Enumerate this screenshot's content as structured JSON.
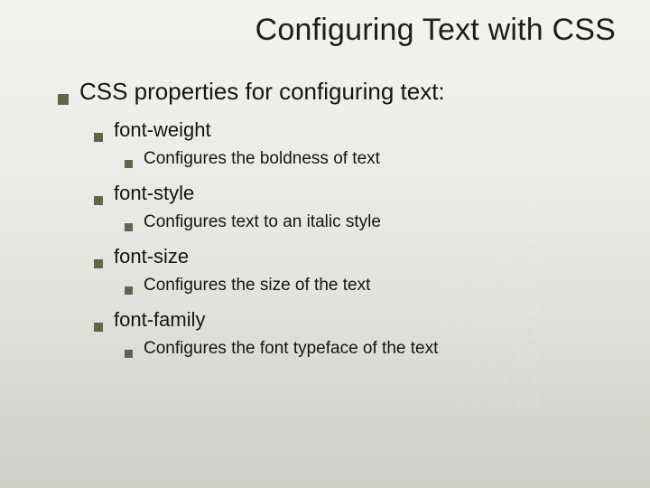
{
  "title": "Configuring Text with CSS",
  "heading": "CSS properties for configuring text:",
  "items": [
    {
      "name": "font-weight",
      "desc": "Configures the boldness of text"
    },
    {
      "name": "font-style",
      "desc": "Configures text to an italic style"
    },
    {
      "name": "font-size",
      "desc": "Configures the size of the text"
    },
    {
      "name": "font-family",
      "desc": "Configures the font typeface of the text"
    }
  ],
  "watermark": "01010101010\n10101010101\n01010101010\n10101010101\n01010101010\n10101010101\n01010101010\n10101010101\n01010101010\n10101010101\n01010101010\n10101010101\n01010101010\n10101010101\n01010101010"
}
